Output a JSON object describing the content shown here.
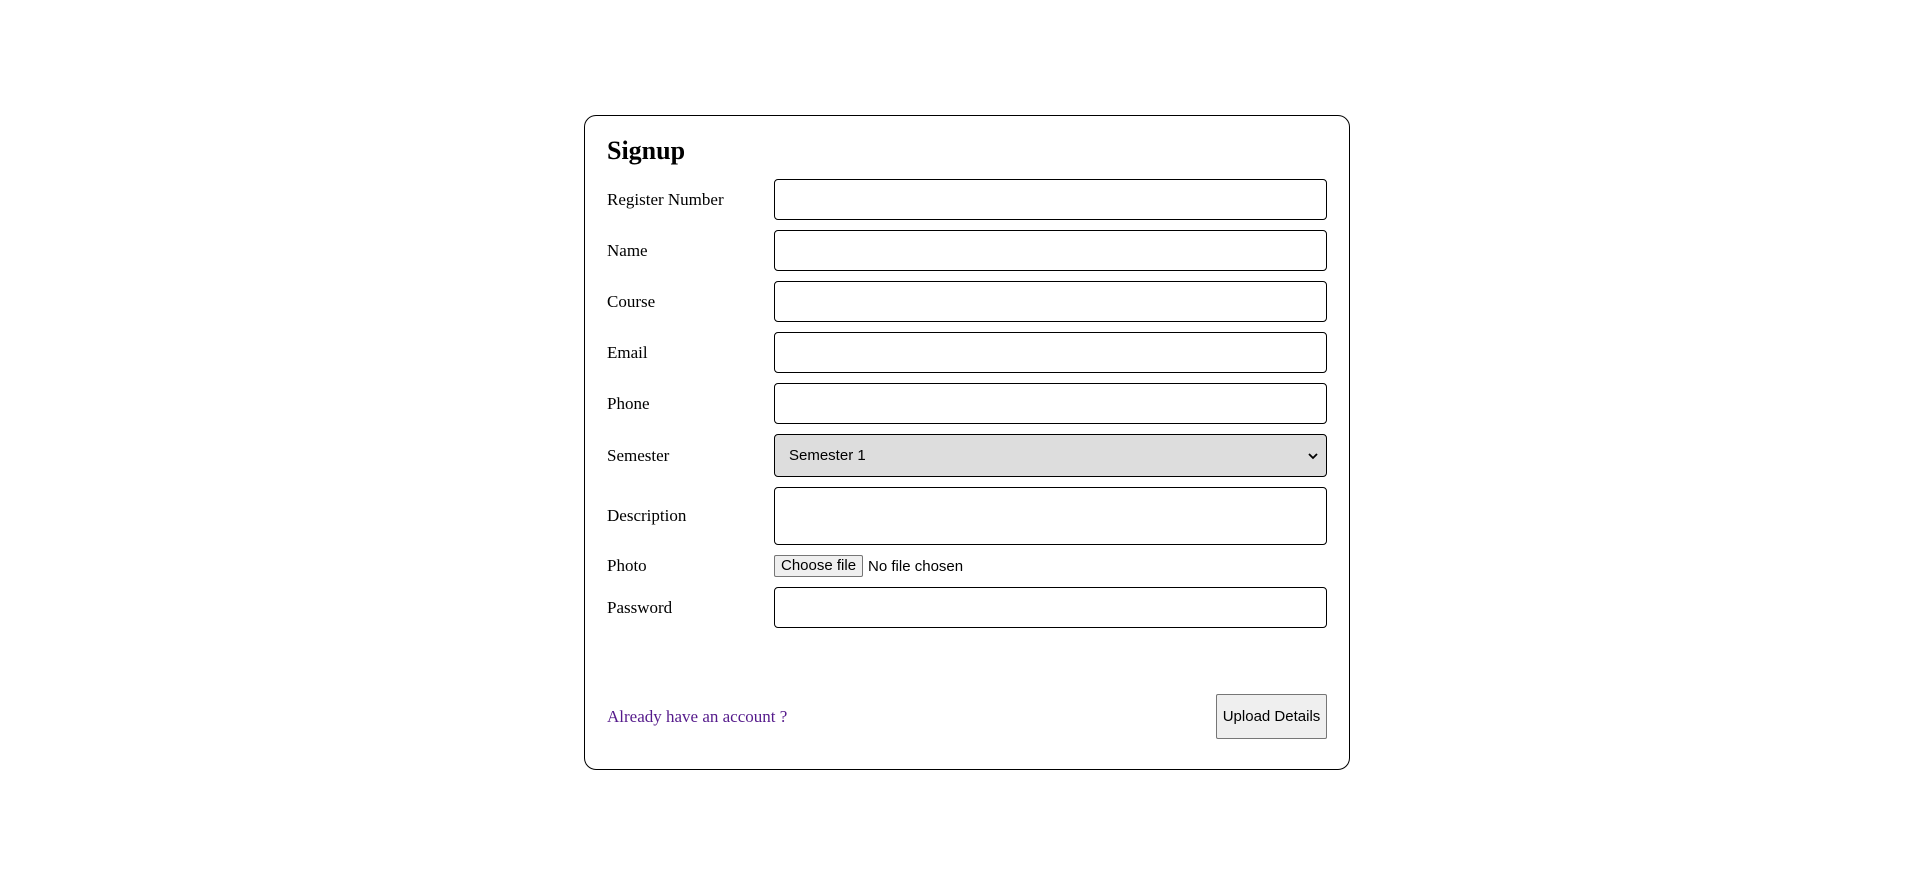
{
  "form": {
    "title": "Signup",
    "fields": {
      "register_number": {
        "label": "Register Number",
        "value": ""
      },
      "name": {
        "label": "Name",
        "value": ""
      },
      "course": {
        "label": "Course",
        "value": ""
      },
      "email": {
        "label": "Email",
        "value": ""
      },
      "phone": {
        "label": "Phone",
        "value": ""
      },
      "semester": {
        "label": "Semester",
        "selected": "Semester 1"
      },
      "description": {
        "label": "Description",
        "value": ""
      },
      "photo": {
        "label": "Photo",
        "button_label": "Choose file",
        "status": "No file chosen"
      },
      "password": {
        "label": "Password",
        "value": ""
      }
    },
    "login_link": "Already have an account ?",
    "submit_label": "Upload Details"
  },
  "icons": {
    "semester_dropdown": "chevron-down-icon"
  },
  "colors": {
    "link": "#551a8b",
    "select_background": "#dddddd",
    "button_background": "#efefef"
  }
}
